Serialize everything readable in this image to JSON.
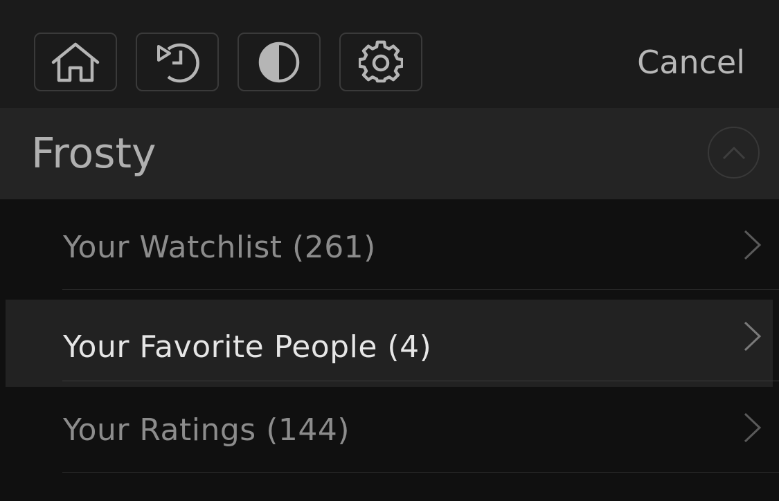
{
  "toolbar": {
    "buttons": [
      {
        "icon": "home-icon"
      },
      {
        "icon": "history-icon"
      },
      {
        "icon": "contrast-icon"
      },
      {
        "icon": "gear-icon"
      }
    ],
    "cancel_label": "Cancel"
  },
  "profile": {
    "name": "Frosty",
    "collapse_icon": "chevron-up-icon"
  },
  "menu": {
    "items": [
      {
        "label": "Your Watchlist",
        "count": "(261)",
        "active": false
      },
      {
        "label": "Your Favorite People",
        "count": "(4)",
        "active": true
      },
      {
        "label": "Your Ratings",
        "count": "(144)",
        "active": false
      }
    ],
    "chevron_icon": "chevron-right-icon"
  },
  "colors": {
    "background": "#101010",
    "toolbar_bg": "#1b1b1b",
    "profile_bg": "#242424",
    "active_row_bg": "#222222",
    "active_text": "#e6e6e6",
    "inactive_text": "#8c8c8c"
  }
}
